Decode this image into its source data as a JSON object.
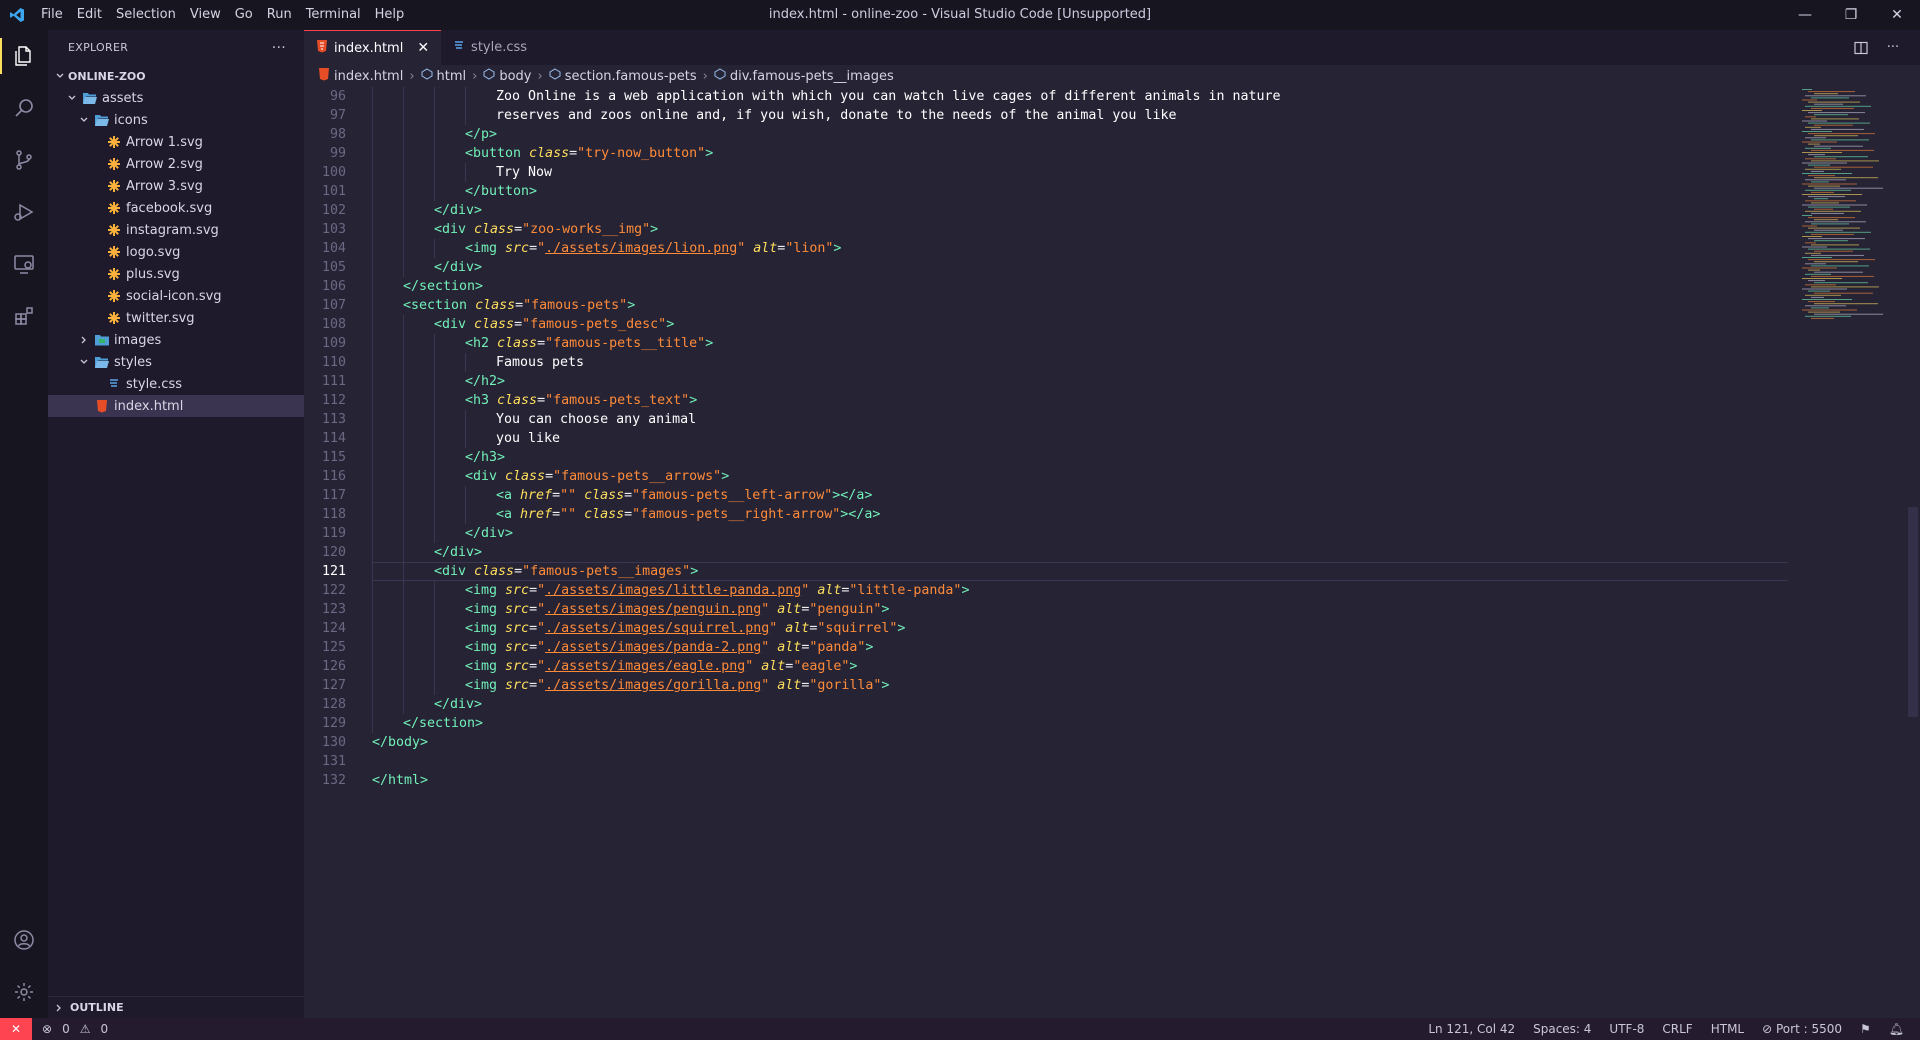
{
  "window": {
    "title": "index.html - online-zoo - Visual Studio Code [Unsupported]",
    "menu": [
      "File",
      "Edit",
      "Selection",
      "View",
      "Go",
      "Run",
      "Terminal",
      "Help"
    ],
    "controls": {
      "minimize": "—",
      "restore": "❐",
      "close": "✕"
    }
  },
  "activity_bar": [
    {
      "name": "explorer-icon",
      "active": true
    },
    {
      "name": "search-icon"
    },
    {
      "name": "source-control-icon"
    },
    {
      "name": "run-debug-icon"
    },
    {
      "name": "remote-explorer-icon"
    },
    {
      "name": "extensions-icon"
    }
  ],
  "sidebar": {
    "title": "EXPLORER",
    "more": "···",
    "root": "ONLINE-ZOO",
    "tree": [
      {
        "label": "assets",
        "type": "folder-open",
        "depth": 1
      },
      {
        "label": "icons",
        "type": "folder-open",
        "depth": 2
      },
      {
        "label": "Arrow 1.svg",
        "type": "svg",
        "depth": 3
      },
      {
        "label": "Arrow 2.svg",
        "type": "svg",
        "depth": 3
      },
      {
        "label": "Arrow 3.svg",
        "type": "svg",
        "depth": 3
      },
      {
        "label": "facebook.svg",
        "type": "svg",
        "depth": 3
      },
      {
        "label": "instagram.svg",
        "type": "svg",
        "depth": 3
      },
      {
        "label": "logo.svg",
        "type": "svg",
        "depth": 3
      },
      {
        "label": "plus.svg",
        "type": "svg",
        "depth": 3
      },
      {
        "label": "social-icon.svg",
        "type": "svg",
        "depth": 3
      },
      {
        "label": "twitter.svg",
        "type": "svg",
        "depth": 3
      },
      {
        "label": "images",
        "type": "folder-closed",
        "depth": 2
      },
      {
        "label": "styles",
        "type": "folder-open",
        "depth": 2
      },
      {
        "label": "style.css",
        "type": "css",
        "depth": 3
      },
      {
        "label": "index.html",
        "type": "html",
        "depth": 2,
        "selected": true
      }
    ],
    "outline": "OUTLINE"
  },
  "tabs": [
    {
      "label": "index.html",
      "active": true,
      "icon": "html"
    },
    {
      "label": "style.css",
      "active": false,
      "icon": "css"
    }
  ],
  "breadcrumb": [
    "index.html",
    "html",
    "body",
    "section.famous-pets",
    "div.famous-pets__images"
  ],
  "current_line": 121,
  "code": [
    {
      "n": 96,
      "i": 4,
      "t": [
        [
          "tx",
          "Zoo Online is a web application with which you can watch live cages of different animals in nature"
        ]
      ]
    },
    {
      "n": 97,
      "i": 4,
      "t": [
        [
          "tx",
          "reserves and zoos online and, if you wish, donate to the needs of the animal you like"
        ]
      ]
    },
    {
      "n": 98,
      "i": 3,
      "t": [
        [
          "tg",
          "</p>"
        ]
      ]
    },
    {
      "n": 99,
      "i": 3,
      "t": [
        [
          "tg",
          "<button "
        ],
        [
          "at",
          "class"
        ],
        [
          "pl",
          "="
        ],
        [
          "st",
          "\"try-now_button\""
        ],
        [
          "tg",
          ">"
        ]
      ]
    },
    {
      "n": 100,
      "i": 4,
      "t": [
        [
          "tx",
          "Try Now"
        ]
      ]
    },
    {
      "n": 101,
      "i": 3,
      "t": [
        [
          "tg",
          "</button>"
        ]
      ]
    },
    {
      "n": 102,
      "i": 2,
      "t": [
        [
          "tg",
          "</div>"
        ]
      ]
    },
    {
      "n": 103,
      "i": 2,
      "t": [
        [
          "tg",
          "<div "
        ],
        [
          "at",
          "class"
        ],
        [
          "pl",
          "="
        ],
        [
          "st",
          "\"zoo-works__img\""
        ],
        [
          "tg",
          ">"
        ]
      ]
    },
    {
      "n": 104,
      "i": 3,
      "t": [
        [
          "tg",
          "<img "
        ],
        [
          "at",
          "src"
        ],
        [
          "pl",
          "="
        ],
        [
          "st",
          "\""
        ],
        [
          "stl",
          "./assets/images/lion.png"
        ],
        [
          "st",
          "\""
        ],
        [
          "pl",
          " "
        ],
        [
          "at",
          "alt"
        ],
        [
          "pl",
          "="
        ],
        [
          "st",
          "\"lion\""
        ],
        [
          "tg",
          ">"
        ]
      ]
    },
    {
      "n": 105,
      "i": 2,
      "t": [
        [
          "tg",
          "</div>"
        ]
      ]
    },
    {
      "n": 106,
      "i": 1,
      "t": [
        [
          "tg",
          "</section>"
        ]
      ]
    },
    {
      "n": 107,
      "i": 1,
      "t": [
        [
          "tg",
          "<section "
        ],
        [
          "at",
          "class"
        ],
        [
          "pl",
          "="
        ],
        [
          "st",
          "\"famous-pets\""
        ],
        [
          "tg",
          ">"
        ]
      ]
    },
    {
      "n": 108,
      "i": 2,
      "t": [
        [
          "tg",
          "<div "
        ],
        [
          "at",
          "class"
        ],
        [
          "pl",
          "="
        ],
        [
          "st",
          "\"famous-pets_desc\""
        ],
        [
          "tg",
          ">"
        ]
      ]
    },
    {
      "n": 109,
      "i": 3,
      "t": [
        [
          "tg",
          "<h2 "
        ],
        [
          "at",
          "class"
        ],
        [
          "pl",
          "="
        ],
        [
          "st",
          "\"famous-pets__title\""
        ],
        [
          "tg",
          ">"
        ]
      ]
    },
    {
      "n": 110,
      "i": 4,
      "t": [
        [
          "tx",
          "Famous pets"
        ]
      ]
    },
    {
      "n": 111,
      "i": 3,
      "t": [
        [
          "tg",
          "</h2>"
        ]
      ]
    },
    {
      "n": 112,
      "i": 3,
      "t": [
        [
          "tg",
          "<h3 "
        ],
        [
          "at",
          "class"
        ],
        [
          "pl",
          "="
        ],
        [
          "st",
          "\"famous-pets_text\""
        ],
        [
          "tg",
          ">"
        ]
      ]
    },
    {
      "n": 113,
      "i": 4,
      "t": [
        [
          "tx",
          "You can choose any animal"
        ]
      ]
    },
    {
      "n": 114,
      "i": 4,
      "t": [
        [
          "tx",
          "you like"
        ]
      ]
    },
    {
      "n": 115,
      "i": 3,
      "t": [
        [
          "tg",
          "</h3>"
        ]
      ]
    },
    {
      "n": 116,
      "i": 3,
      "t": [
        [
          "tg",
          "<div "
        ],
        [
          "at",
          "class"
        ],
        [
          "pl",
          "="
        ],
        [
          "st",
          "\"famous-pets__arrows\""
        ],
        [
          "tg",
          ">"
        ]
      ]
    },
    {
      "n": 117,
      "i": 4,
      "t": [
        [
          "tg",
          "<a "
        ],
        [
          "at",
          "href"
        ],
        [
          "pl",
          "="
        ],
        [
          "st",
          "\"\""
        ],
        [
          "pl",
          " "
        ],
        [
          "at",
          "class"
        ],
        [
          "pl",
          "="
        ],
        [
          "st",
          "\"famous-pets__left-arrow\""
        ],
        [
          "tg",
          "></a>"
        ]
      ]
    },
    {
      "n": 118,
      "i": 4,
      "t": [
        [
          "tg",
          "<a "
        ],
        [
          "at",
          "href"
        ],
        [
          "pl",
          "="
        ],
        [
          "st",
          "\"\""
        ],
        [
          "pl",
          " "
        ],
        [
          "at",
          "class"
        ],
        [
          "pl",
          "="
        ],
        [
          "st",
          "\"famous-pets__right-arrow\""
        ],
        [
          "tg",
          "></a>"
        ]
      ]
    },
    {
      "n": 119,
      "i": 3,
      "t": [
        [
          "tg",
          "</div>"
        ]
      ]
    },
    {
      "n": 120,
      "i": 2,
      "t": [
        [
          "tg",
          "</div>"
        ]
      ]
    },
    {
      "n": 121,
      "i": 2,
      "t": [
        [
          "tg",
          "<div "
        ],
        [
          "at",
          "class"
        ],
        [
          "pl",
          "="
        ],
        [
          "st",
          "\"famous-pets__images\""
        ],
        [
          "tg",
          ">"
        ]
      ]
    },
    {
      "n": 122,
      "i": 3,
      "t": [
        [
          "tg",
          "<img "
        ],
        [
          "at",
          "src"
        ],
        [
          "pl",
          "="
        ],
        [
          "st",
          "\""
        ],
        [
          "stl",
          "./assets/images/little-panda.png"
        ],
        [
          "st",
          "\""
        ],
        [
          "pl",
          " "
        ],
        [
          "at",
          "alt"
        ],
        [
          "pl",
          "="
        ],
        [
          "st",
          "\"little-panda\""
        ],
        [
          "tg",
          ">"
        ]
      ]
    },
    {
      "n": 123,
      "i": 3,
      "t": [
        [
          "tg",
          "<img "
        ],
        [
          "at",
          "src"
        ],
        [
          "pl",
          "="
        ],
        [
          "st",
          "\""
        ],
        [
          "stl",
          "./assets/images/penguin.png"
        ],
        [
          "st",
          "\""
        ],
        [
          "pl",
          " "
        ],
        [
          "at",
          "alt"
        ],
        [
          "pl",
          "="
        ],
        [
          "st",
          "\"penguin\""
        ],
        [
          "tg",
          ">"
        ]
      ]
    },
    {
      "n": 124,
      "i": 3,
      "t": [
        [
          "tg",
          "<img "
        ],
        [
          "at",
          "src"
        ],
        [
          "pl",
          "="
        ],
        [
          "st",
          "\""
        ],
        [
          "stl",
          "./assets/images/squirrel.png"
        ],
        [
          "st",
          "\""
        ],
        [
          "pl",
          " "
        ],
        [
          "at",
          "alt"
        ],
        [
          "pl",
          "="
        ],
        [
          "st",
          "\"squirrel\""
        ],
        [
          "tg",
          ">"
        ]
      ]
    },
    {
      "n": 125,
      "i": 3,
      "t": [
        [
          "tg",
          "<img "
        ],
        [
          "at",
          "src"
        ],
        [
          "pl",
          "="
        ],
        [
          "st",
          "\""
        ],
        [
          "stl",
          "./assets/images/panda-2.png"
        ],
        [
          "st",
          "\""
        ],
        [
          "pl",
          " "
        ],
        [
          "at",
          "alt"
        ],
        [
          "pl",
          "="
        ],
        [
          "st",
          "\"panda\""
        ],
        [
          "tg",
          ">"
        ]
      ]
    },
    {
      "n": 126,
      "i": 3,
      "t": [
        [
          "tg",
          "<img "
        ],
        [
          "at",
          "src"
        ],
        [
          "pl",
          "="
        ],
        [
          "st",
          "\""
        ],
        [
          "stl",
          "./assets/images/eagle.png"
        ],
        [
          "st",
          "\""
        ],
        [
          "pl",
          " "
        ],
        [
          "at",
          "alt"
        ],
        [
          "pl",
          "="
        ],
        [
          "st",
          "\"eagle\""
        ],
        [
          "tg",
          ">"
        ]
      ]
    },
    {
      "n": 127,
      "i": 3,
      "t": [
        [
          "tg",
          "<img "
        ],
        [
          "at",
          "src"
        ],
        [
          "pl",
          "="
        ],
        [
          "st",
          "\""
        ],
        [
          "stl",
          "./assets/images/gorilla.png"
        ],
        [
          "st",
          "\""
        ],
        [
          "pl",
          " "
        ],
        [
          "at",
          "alt"
        ],
        [
          "pl",
          "="
        ],
        [
          "st",
          "\"gorilla\""
        ],
        [
          "tg",
          ">"
        ]
      ]
    },
    {
      "n": 128,
      "i": 2,
      "t": [
        [
          "tg",
          "</div>"
        ]
      ]
    },
    {
      "n": 129,
      "i": 1,
      "t": [
        [
          "tg",
          "</section>"
        ]
      ]
    },
    {
      "n": 130,
      "i": 0,
      "t": [
        [
          "tg",
          "</body>"
        ]
      ]
    },
    {
      "n": 131,
      "i": 0,
      "t": []
    },
    {
      "n": 132,
      "i": 0,
      "t": [
        [
          "tg",
          "</html>"
        ]
      ]
    }
  ],
  "status": {
    "remote": "✕",
    "errors": "0",
    "warnings": "0",
    "position": "Ln 121, Col 42",
    "spaces": "Spaces: 4",
    "encoding": "UTF-8",
    "eol": "CRLF",
    "language": "HTML",
    "port": "Port : 5500"
  },
  "colors": {
    "accent": "#fe4450",
    "tag": "#72f1b8",
    "attr": "#fede5d",
    "string": "#ff8b39",
    "bg": "#262335"
  }
}
